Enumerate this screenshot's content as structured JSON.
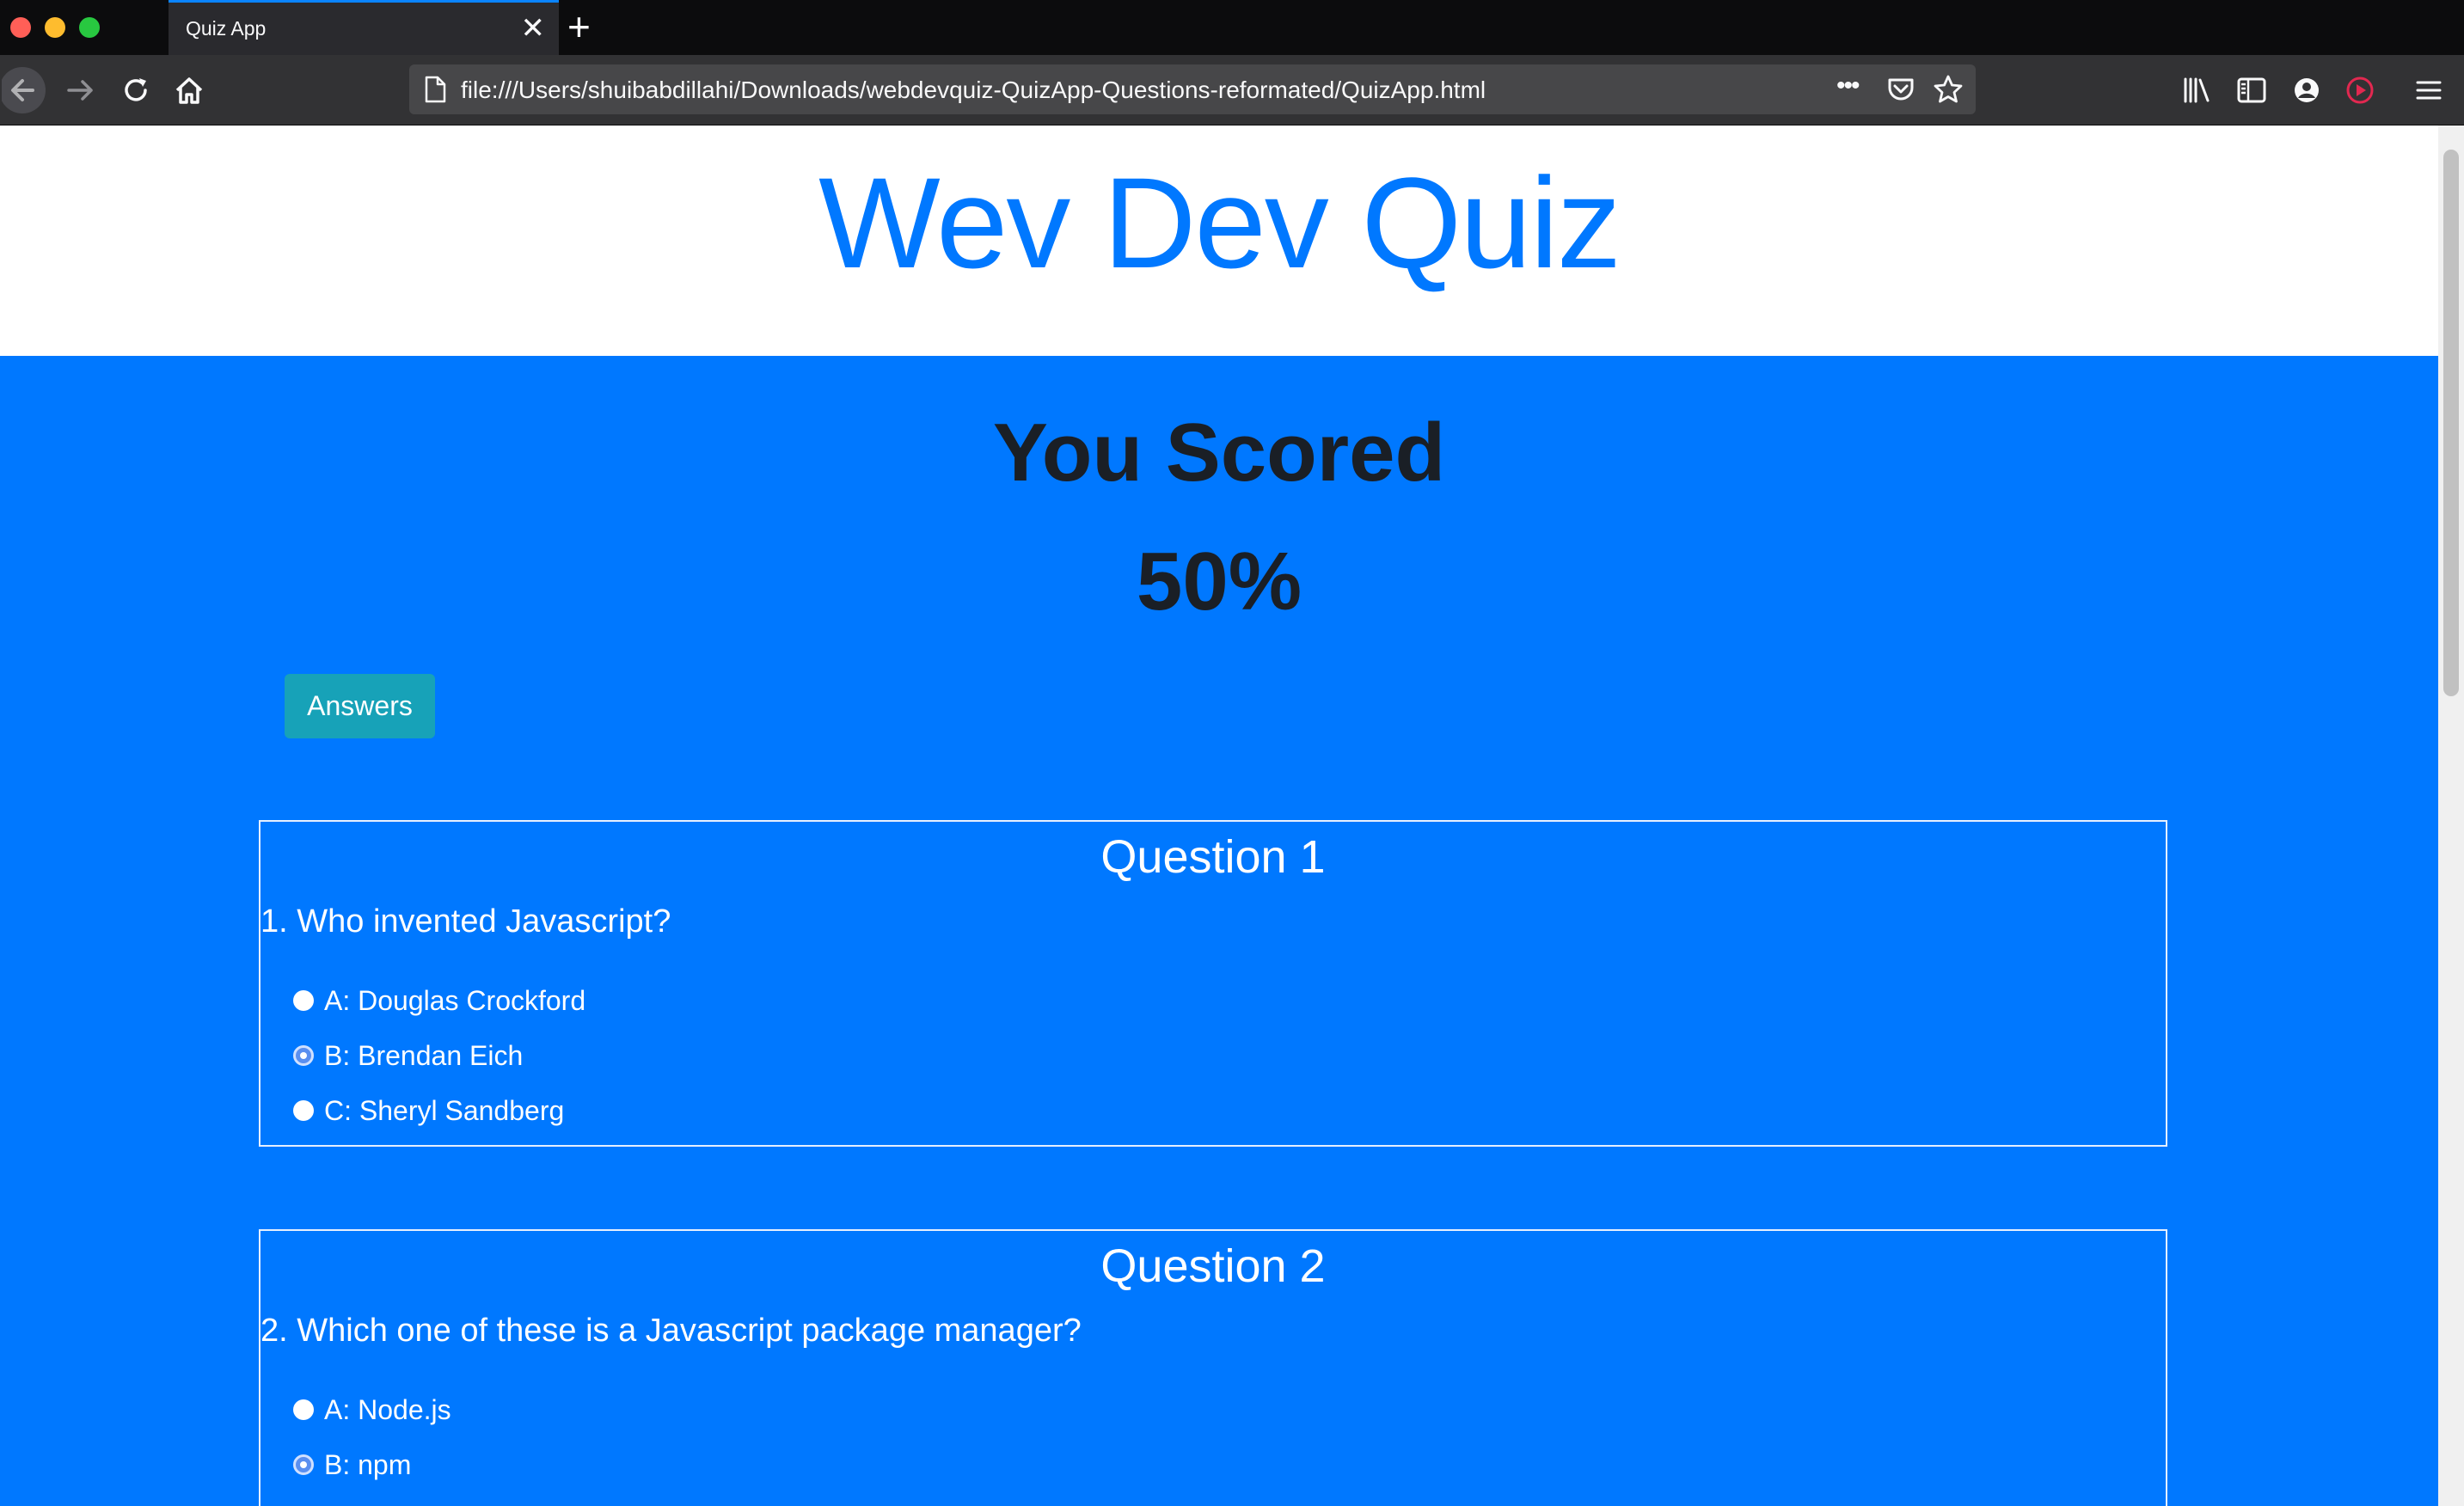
{
  "browser": {
    "tab_title": "Quiz App",
    "tab_close_glyph": "✕",
    "new_tab_glyph": "+",
    "url": "file:///Users/shuibabdillahi/Downloads/webdevquiz-QuizApp-Questions-reformated/QuizApp.html",
    "page_actions_glyph": "•••",
    "icons": [
      "back-icon",
      "forward-icon",
      "reload-icon",
      "home-icon",
      "page-icon",
      "pocket-icon",
      "bookmark-star-icon",
      "library-icon",
      "sidebar-icon",
      "account-icon",
      "extension-icon",
      "menu-icon"
    ],
    "traffic_lights": {
      "close": "#ff5f57",
      "minimize": "#febc2e",
      "maximize": "#28c840"
    },
    "accent": "#0a84ff"
  },
  "page": {
    "title": "Wev Dev Quiz",
    "score_label": "You Scored",
    "score_value": "50%",
    "answers_button": "Answers",
    "colors": {
      "primary": "#0078ff",
      "dark_text": "#1a1f26",
      "button": "#17a2b8"
    }
  },
  "questions": [
    {
      "heading": "Question 1",
      "text": "1. Who invented Javascript?",
      "options": [
        {
          "label": "A: Douglas Crockford",
          "selected": false
        },
        {
          "label": "B: Brendan Eich",
          "selected": true
        },
        {
          "label": "C: Sheryl Sandberg",
          "selected": false
        }
      ]
    },
    {
      "heading": "Question 2",
      "text": "2. Which one of these is a Javascript package manager?",
      "options": [
        {
          "label": "A: Node.js",
          "selected": false
        },
        {
          "label": "B: npm",
          "selected": true
        }
      ]
    }
  ]
}
